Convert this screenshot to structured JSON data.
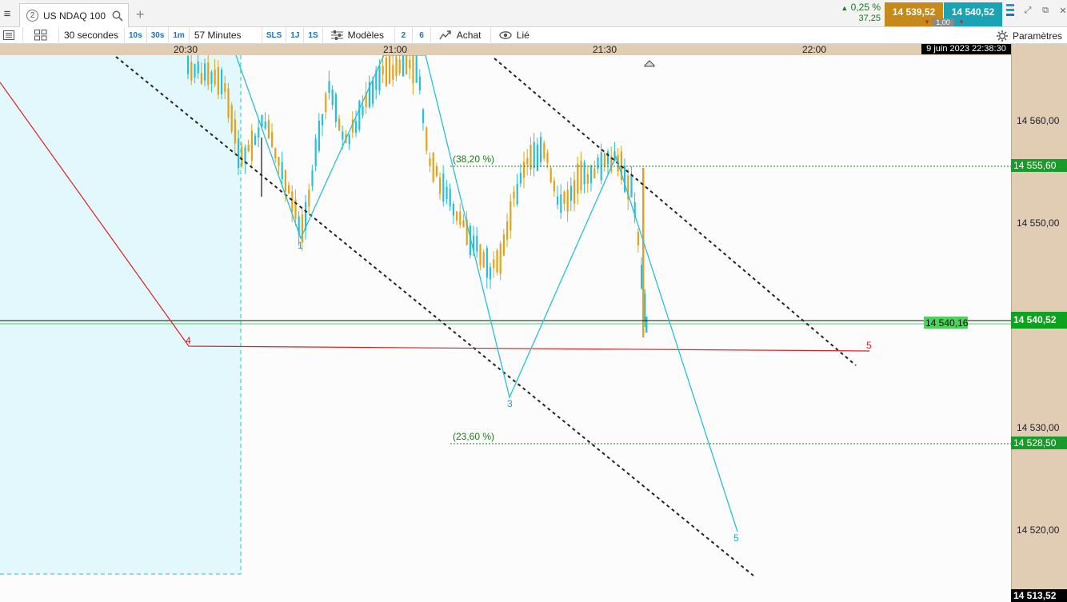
{
  "window": {
    "tab_number": "2",
    "tab_title": "US NDAQ 100",
    "add_tab": "+"
  },
  "quote": {
    "change_pct": "0,25 %",
    "change_pts": "37,25",
    "bid": "14 539,52",
    "ask": "14 540,52",
    "spread": "1,00",
    "colors": {
      "bid": "#c58a1a",
      "ask": "#1aa3b5",
      "up": "#1a7a1a"
    }
  },
  "toolbar": {
    "interval": "30 secondes",
    "quick_intervals": [
      "10s",
      "30s",
      "1m"
    ],
    "range": "57 Minutes",
    "quick_ranges": [
      "SLS",
      "1J",
      "1S"
    ],
    "models": "Modèles",
    "layout_buttons": [
      "2",
      "6"
    ],
    "buy": "Achat",
    "linked": "Lié",
    "settings": "Paramètres"
  },
  "time_axis": {
    "labels": [
      "20:30",
      "21:00",
      "21:30",
      "22:00"
    ],
    "datetime": "9 juin 2023 22:38:30"
  },
  "price_axis": {
    "labels": [
      "14 560,00",
      "14 550,00",
      "14 530,00",
      "14 520,00"
    ],
    "current": "14 540,52",
    "bottom": "14 513,52",
    "fib_upper": "14 555,60",
    "fib_lower": "14 528,50",
    "hline_label": "14 540,16"
  },
  "chart_data": {
    "type": "candlestick",
    "instrument": "US NDAQ 100",
    "x_range": [
      "20:30",
      "22:00"
    ],
    "y_range": [
      14513.52,
      14560.0
    ],
    "fibonacci": [
      {
        "label": "(38,20 %)",
        "value": 14555.6
      },
      {
        "label": "(23,60 %)",
        "value": 14528.5
      }
    ],
    "horizontal_line": 14540.16,
    "current_price": 14540.52,
    "wave_labels_blue": [
      "1",
      "3",
      "5"
    ],
    "wave_labels_red": [
      "4",
      "5"
    ]
  }
}
